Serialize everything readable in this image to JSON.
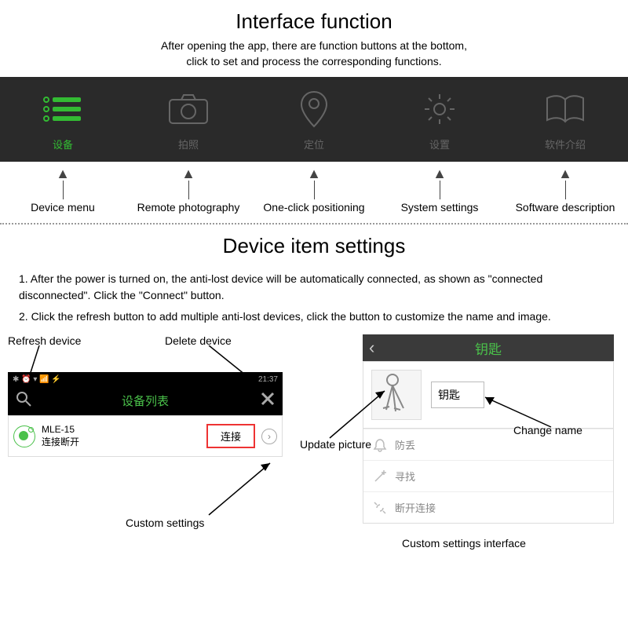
{
  "section1": {
    "title": "Interface function",
    "desc1": "After opening the app, there are function buttons at the bottom,",
    "desc2": "click to set and process the corresponding functions.",
    "tabs": [
      {
        "cn": "设备",
        "en": "Device menu",
        "active": true
      },
      {
        "cn": "拍照",
        "en": "Remote photography",
        "active": false
      },
      {
        "cn": "定位",
        "en": "One-click positioning",
        "active": false
      },
      {
        "cn": "设置",
        "en": "System settings",
        "active": false
      },
      {
        "cn": "软件介绍",
        "en": "Software description",
        "active": false
      }
    ]
  },
  "section2": {
    "title": "Device item settings",
    "inst1": "1. After the power is turned on, the anti-lost device will be automatically connected, as shown as \"connected disconnected\". Click the \"Connect\" button.",
    "inst2": "2. Click the refresh button to add multiple anti-lost devices, click the button to customize the name and image."
  },
  "left_phone": {
    "status_time": "21:37",
    "header": "设备列表",
    "device_name": "MLE-15",
    "device_status": "连接断开",
    "connect_btn": "连接",
    "callout_refresh": "Refresh device",
    "callout_delete": "Delete device",
    "callout_custom": "Custom settings"
  },
  "right_phone": {
    "header": "钥匙",
    "name_value": "钥匙",
    "menu": [
      "防丢",
      "寻找",
      "断开连接"
    ],
    "callout_update": "Update picture",
    "callout_change": "Change name",
    "caption": "Custom settings interface"
  }
}
